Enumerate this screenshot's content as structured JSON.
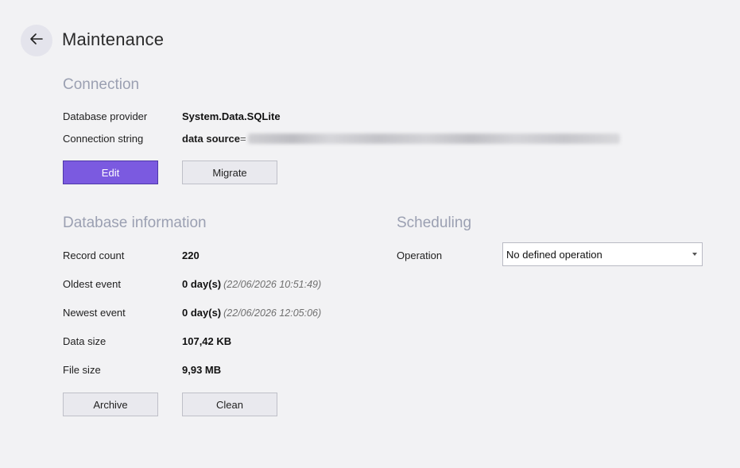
{
  "header": {
    "title": "Maintenance",
    "back_icon": "arrow-left-icon"
  },
  "connection": {
    "heading": "Connection",
    "provider_label": "Database provider",
    "provider_value": "System.Data.SQLite",
    "string_label": "Connection string",
    "string_key": "data source",
    "string_eq": "=",
    "edit_label": "Edit",
    "migrate_label": "Migrate"
  },
  "database_info": {
    "heading": "Database information",
    "record_count_label": "Record count",
    "record_count_value": "220",
    "oldest_label": "Oldest event",
    "oldest_value": "0 day(s)",
    "oldest_timestamp": "(22/06/2026 10:51:49)",
    "newest_label": "Newest event",
    "newest_value": "0 day(s)",
    "newest_timestamp": "(22/06/2026 12:05:06)",
    "data_size_label": "Data size",
    "data_size_value": "107,42 KB",
    "file_size_label": "File size",
    "file_size_value": "9,93 MB",
    "archive_label": "Archive",
    "clean_label": "Clean"
  },
  "scheduling": {
    "heading": "Scheduling",
    "operation_label": "Operation",
    "operation_value": "No defined operation"
  },
  "colors": {
    "accent": "#7b5ae0",
    "heading": "#9ba0b2",
    "background": "#f2f2f4"
  }
}
